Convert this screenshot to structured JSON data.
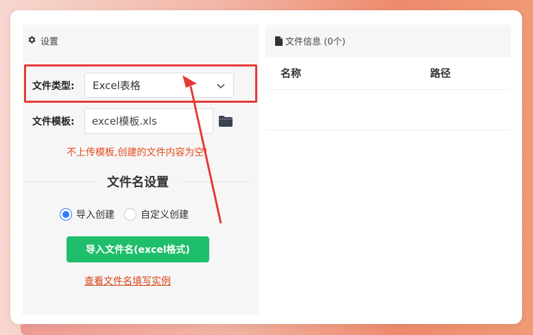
{
  "settings": {
    "header": "设置",
    "file_type_label": "文件类型:",
    "file_type_value": "Excel表格",
    "template_label": "文件模板:",
    "template_value": "excel模板.xls",
    "warning": "不上传模板,创建的文件内容为空!",
    "section_title": "文件名设置",
    "radio_options": [
      "导入创建",
      "自定义创建"
    ],
    "radio_selected": "导入创建",
    "import_button": "导入文件名(excel格式)",
    "example_link": "查看文件名填写实例"
  },
  "file_info": {
    "header": "文件信息 (0个)",
    "columns": [
      "名称",
      "路径"
    ]
  },
  "colors": {
    "accent_green": "#1fbe6b",
    "highlight_red": "#e53935",
    "warning_orange": "#e64a19",
    "radio_blue": "#2b7cff"
  },
  "icons": [
    "gear-icon",
    "chevron-down-icon",
    "folder-icon",
    "file-icon"
  ]
}
